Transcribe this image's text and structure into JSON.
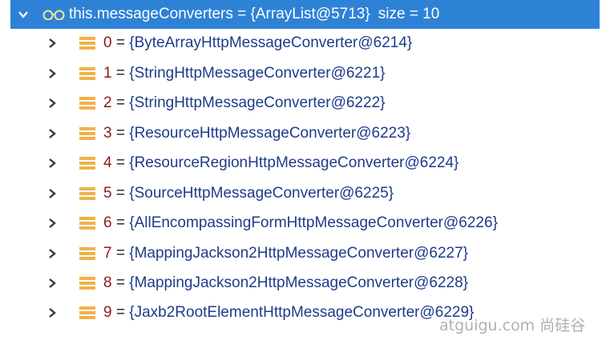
{
  "colors": {
    "selection_bg": "#2e82d6",
    "index_color": "#8b1a1a",
    "value_color": "#1f3b8a",
    "icon_color": "#f0b24a"
  },
  "root": {
    "expander_icon": "chevron-down-icon",
    "type_icon": "glasses-icon",
    "label": "this.messageConverters = {ArrayList@5713}",
    "size": "size = 10"
  },
  "items": [
    {
      "index": "0",
      "eq": " = ",
      "value": "{ByteArrayHttpMessageConverter@6214}"
    },
    {
      "index": "1",
      "eq": " = ",
      "value": "{StringHttpMessageConverter@6221}"
    },
    {
      "index": "2",
      "eq": " = ",
      "value": "{StringHttpMessageConverter@6222}"
    },
    {
      "index": "3",
      "eq": " = ",
      "value": "{ResourceHttpMessageConverter@6223}"
    },
    {
      "index": "4",
      "eq": " = ",
      "value": "{ResourceRegionHttpMessageConverter@6224}"
    },
    {
      "index": "5",
      "eq": " = ",
      "value": "{SourceHttpMessageConverter@6225}"
    },
    {
      "index": "6",
      "eq": " = ",
      "value": "{AllEncompassingFormHttpMessageConverter@6226}"
    },
    {
      "index": "7",
      "eq": " = ",
      "value": "{MappingJackson2HttpMessageConverter@6227}"
    },
    {
      "index": "8",
      "eq": " = ",
      "value": "{MappingJackson2HttpMessageConverter@6228}"
    },
    {
      "index": "9",
      "eq": " = ",
      "value": "{Jaxb2RootElementHttpMessageConverter@6229}"
    }
  ],
  "watermark": "atguigu.com 尚硅谷"
}
